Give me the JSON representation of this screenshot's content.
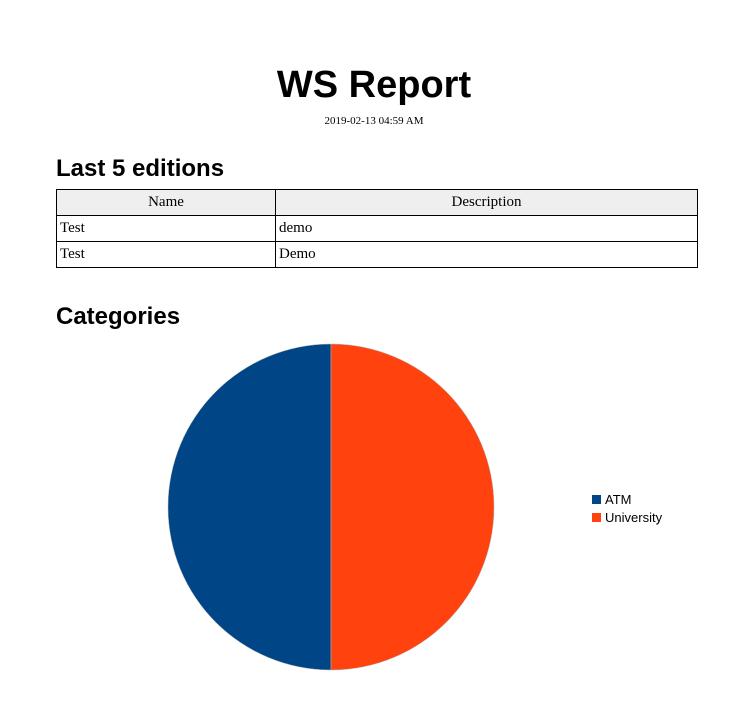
{
  "report": {
    "title": "WS Report",
    "date": "2019-02-13 04:59 AM"
  },
  "editions": {
    "heading": "Last 5 editions",
    "columns": [
      "Name",
      "Description"
    ],
    "rows": [
      [
        "Test",
        "demo"
      ],
      [
        "Test",
        "Demo"
      ]
    ]
  },
  "categories": {
    "heading": "Categories"
  },
  "chart_data": {
    "type": "pie",
    "title": "",
    "labels": [
      "ATM",
      "University"
    ],
    "values": [
      50,
      50
    ],
    "colors": [
      "#004586",
      "#ff420e"
    ],
    "legend": "right",
    "start_angle": "12 o'clock, counter-clockwise"
  }
}
